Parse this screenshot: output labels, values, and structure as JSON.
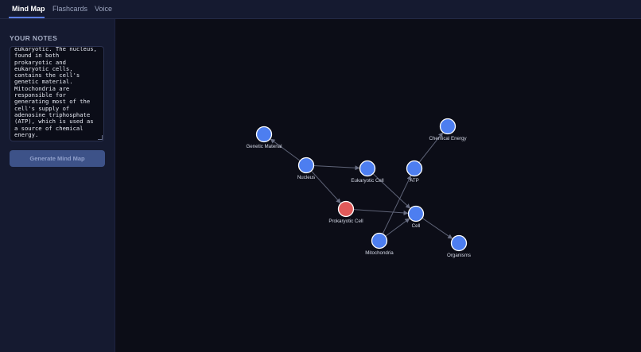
{
  "tabs": [
    {
      "label": "Mind Map",
      "active": true
    },
    {
      "label": "Flashcards",
      "active": false
    },
    {
      "label": "Voice",
      "active": false
    }
  ],
  "sidebar": {
    "heading": "YOUR NOTES",
    "notes_text": "eukaryotic. The nucleus,\nfound in both\nprokaryotic and\neukaryotic cells,\ncontains the cell's\ngenetic material.\nMitochondria are\nresponsible for\ngenerating most of the\ncell's supply of\nadenosine triphosphate\n(ATP), which is used as\na source of chemical\nenergy.",
    "generate_label": "Generate Mind Map"
  },
  "colors": {
    "node_default": "#4d7ef0",
    "node_selected": "#e05a5a",
    "edge": "#5f6478",
    "label_selected": "#f08a8a"
  },
  "mind_map": {
    "nodes": [
      {
        "id": "genetic",
        "label": "Genetic Material",
        "selected": false
      },
      {
        "id": "nucleus",
        "label": "Nucleus",
        "selected": false
      },
      {
        "id": "eukaryotic",
        "label": "Eukaryotic Cell",
        "selected": false
      },
      {
        "id": "atp",
        "label": "ATP",
        "selected": false
      },
      {
        "id": "chemical",
        "label": "Chemical Energy",
        "selected": false
      },
      {
        "id": "prokaryotic",
        "label": "Prokaryotic Cell",
        "selected": true
      },
      {
        "id": "cell",
        "label": "Cell",
        "selected": false
      },
      {
        "id": "mitochondria",
        "label": "Mitochondria",
        "selected": false
      },
      {
        "id": "organisms",
        "label": "Organisms",
        "selected": false
      }
    ],
    "edges": [
      {
        "from": "nucleus",
        "to": "genetic"
      },
      {
        "from": "nucleus",
        "to": "eukaryotic"
      },
      {
        "from": "nucleus",
        "to": "prokaryotic"
      },
      {
        "from": "eukaryotic",
        "to": "cell"
      },
      {
        "from": "prokaryotic",
        "to": "cell"
      },
      {
        "from": "atp",
        "to": "chemical"
      },
      {
        "from": "mitochondria",
        "to": "atp"
      },
      {
        "from": "mitochondria",
        "to": "cell"
      },
      {
        "from": "cell",
        "to": "organisms"
      }
    ]
  }
}
